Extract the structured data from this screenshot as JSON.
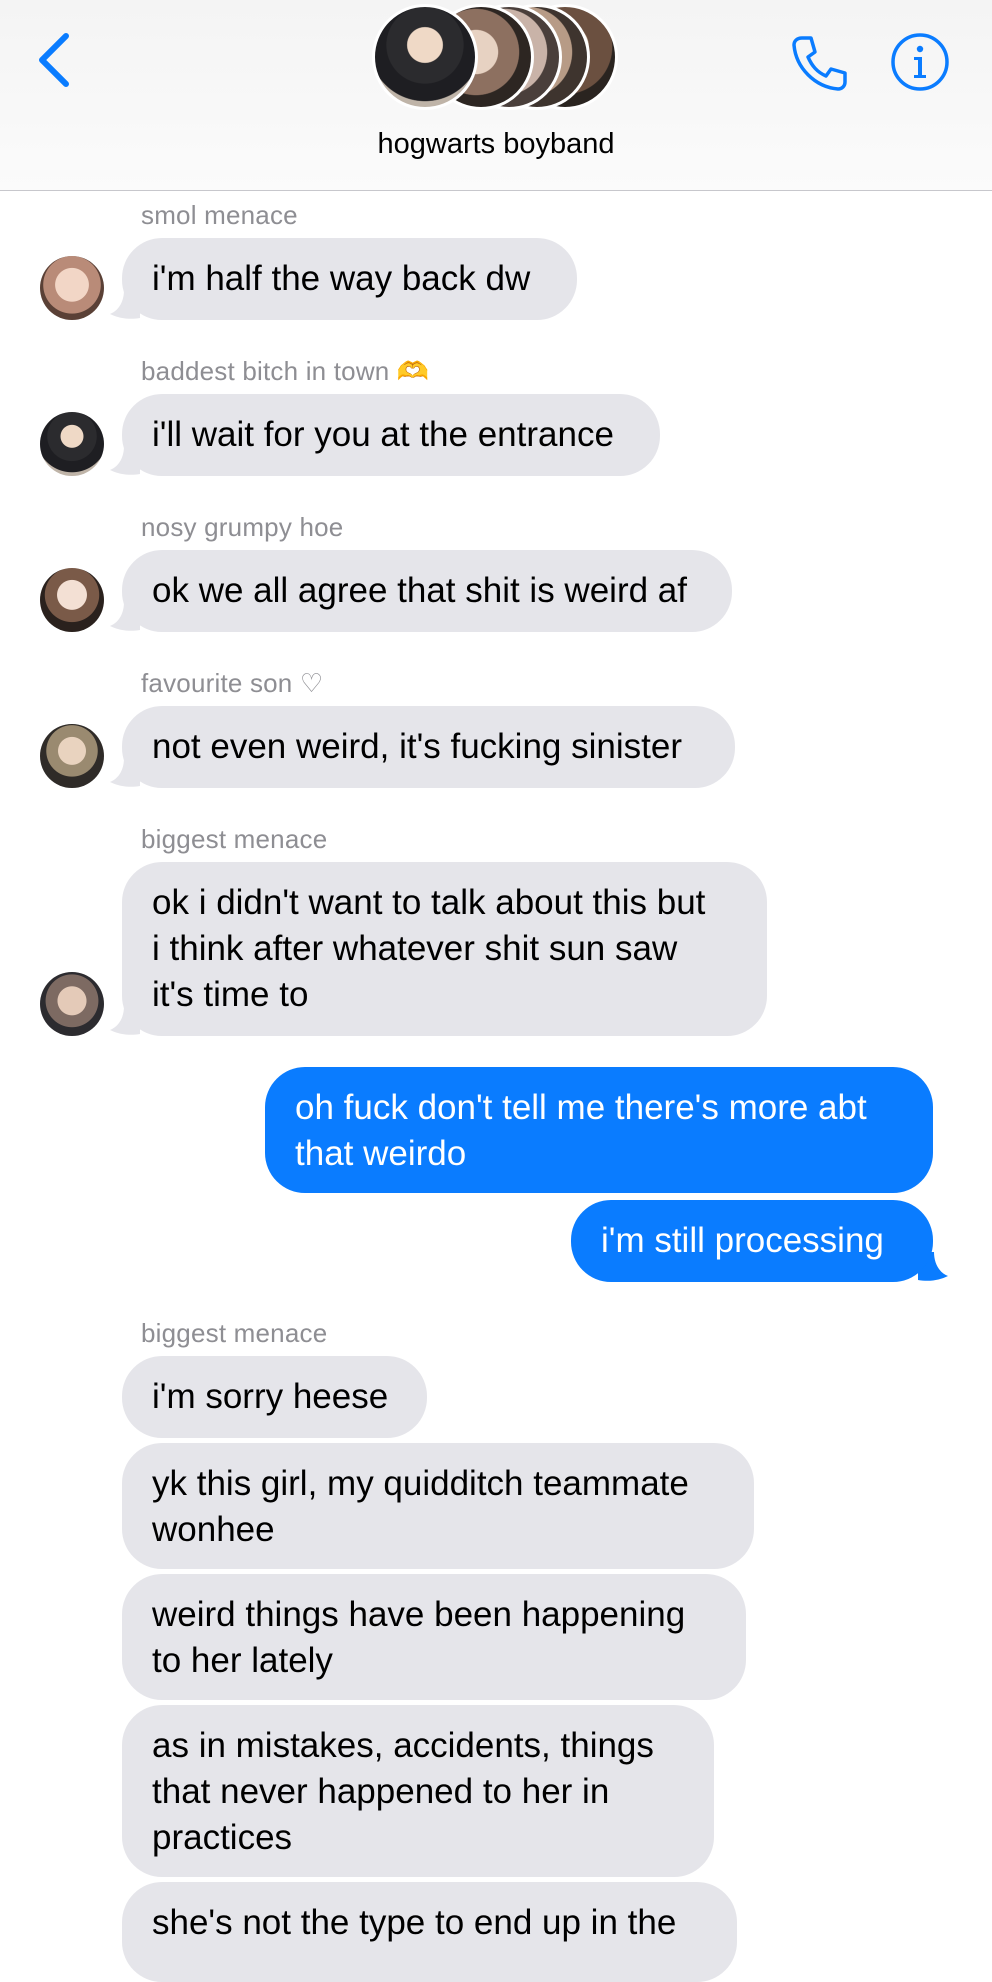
{
  "header": {
    "group_name": "hogwarts boyband",
    "back_icon": "chevron-left-icon",
    "call_icon": "phone-icon",
    "info_icon": "info-icon",
    "accent_color": "#0a7cff"
  },
  "messages": [
    {
      "sender": "smol menace",
      "text": "i'm half the way back dw"
    },
    {
      "sender": "baddest bitch in town 🫶",
      "text": "i'll wait for you at the entrance"
    },
    {
      "sender": "nosy grumpy hoe",
      "text": "ok we all agree that shit is weird af"
    },
    {
      "sender": "favourite son ♡",
      "text": "not even weird, it's fucking sinister"
    },
    {
      "sender": "biggest menace",
      "text": "ok i didn't want to talk about this but\ni think after whatever shit sun saw\nit's time to"
    },
    {
      "sender": "",
      "text": "oh fuck don't tell me there's more abt\nthat weirdo"
    },
    {
      "sender": "",
      "text": "i'm still processing"
    },
    {
      "sender": "biggest menace",
      "text": "i'm sorry heese"
    },
    {
      "sender": "",
      "text": "yk this girl, my quidditch teammate\nwonhee"
    },
    {
      "sender": "",
      "text": "weird things have been happening\nto her lately"
    },
    {
      "sender": "",
      "text": "as in mistakes, accidents, things\nthat never happened to her in\npractices"
    },
    {
      "sender": "",
      "text": "she's not the type to end up in the"
    }
  ]
}
